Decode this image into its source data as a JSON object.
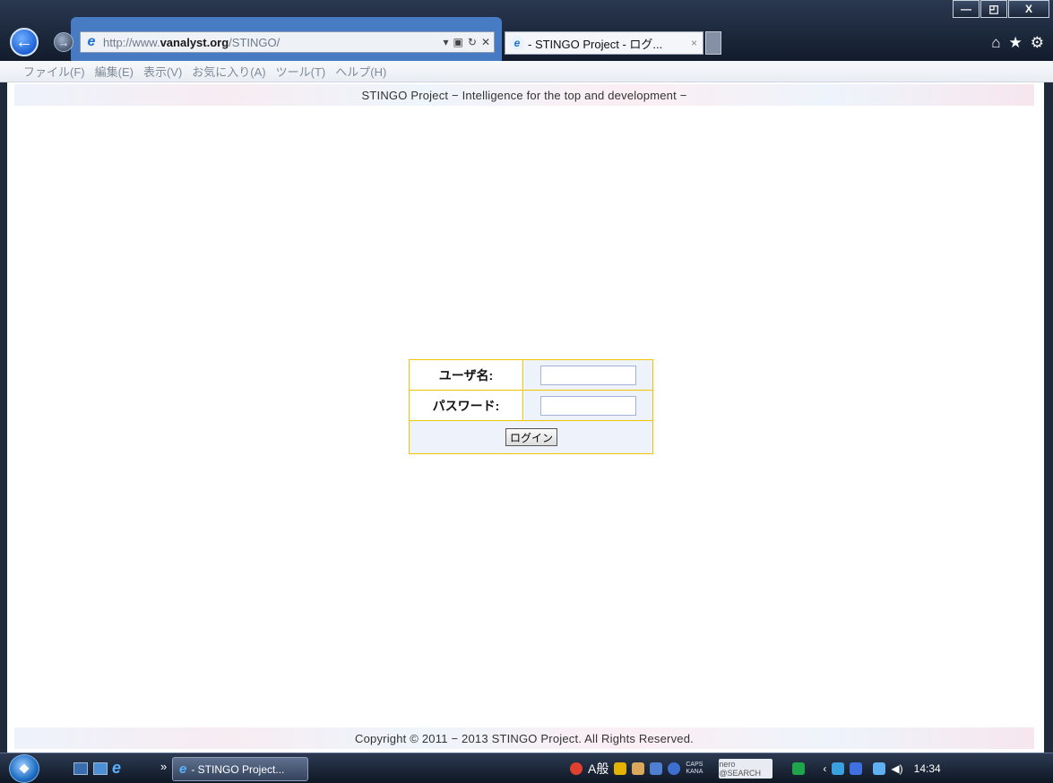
{
  "window_controls": {
    "minimize": "—",
    "restore": "◰",
    "close": "X"
  },
  "address_bar": {
    "url_prefix": "http://www.",
    "url_domain": "vanalyst.org",
    "url_path": "/STINGO/"
  },
  "tab": {
    "title": "- STINGO Project - ログ...",
    "close": "×"
  },
  "menu": [
    "ファイル(F)",
    "編集(E)",
    "表示(V)",
    "お気に入り(A)",
    "ツール(T)",
    "ヘルプ(H)"
  ],
  "page": {
    "header_banner": "STINGO Project  − Intelligence for the top and development −",
    "footer_banner": "Copyright © 2011 − 2013 STINGO Project. All Rights Reserved."
  },
  "login": {
    "username_label": "ユーザ名:",
    "password_label": "パスワード:",
    "username_value": "",
    "password_value": "",
    "button_label": "ログイン"
  },
  "taskbar": {
    "task_title": "- STINGO Project...",
    "ime_mode": "A般",
    "caps": "CAPS",
    "kana": "KANA",
    "nero": "nero @SEARCH",
    "time": "14:34"
  },
  "colors": {
    "table_border": "#f0c400",
    "accent_blue": "#4a7fcb"
  }
}
